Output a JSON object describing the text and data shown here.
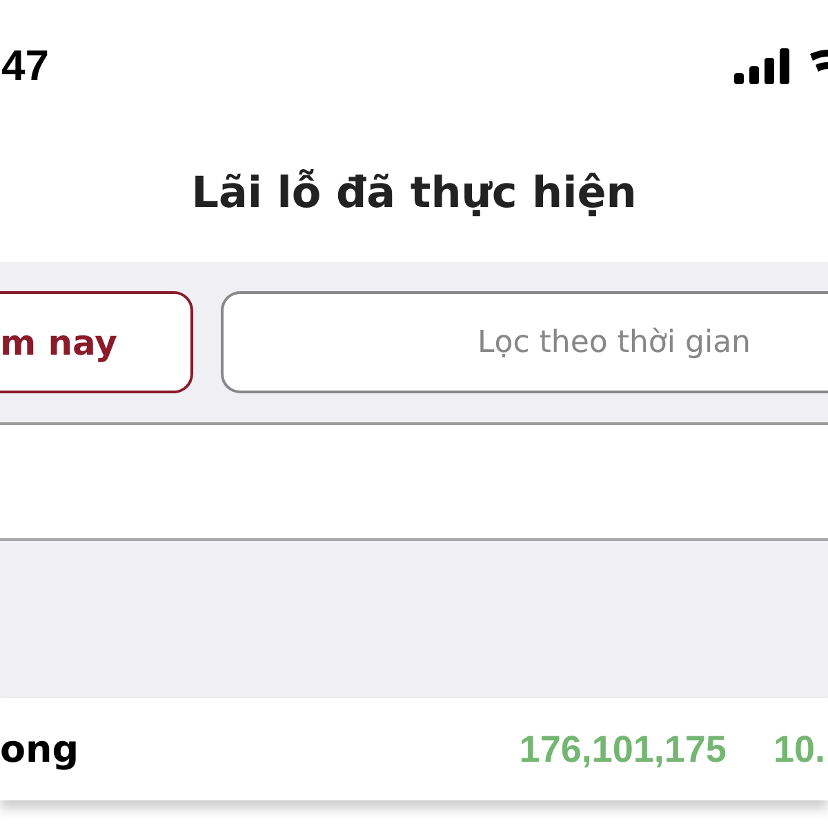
{
  "status_bar": {
    "time": "47"
  },
  "title": "Lãi lỗ đã thực hiện",
  "filters": [
    {
      "label": "m nay",
      "selected": true
    }
  ],
  "date_filter": {
    "placeholder": "Lọc theo thời gian"
  },
  "total_row": {
    "label": "ong",
    "columns": [
      {
        "text": "176,101,175",
        "color": "#74b672"
      },
      {
        "text": "10.",
        "color": "#74b672"
      }
    ]
  }
}
